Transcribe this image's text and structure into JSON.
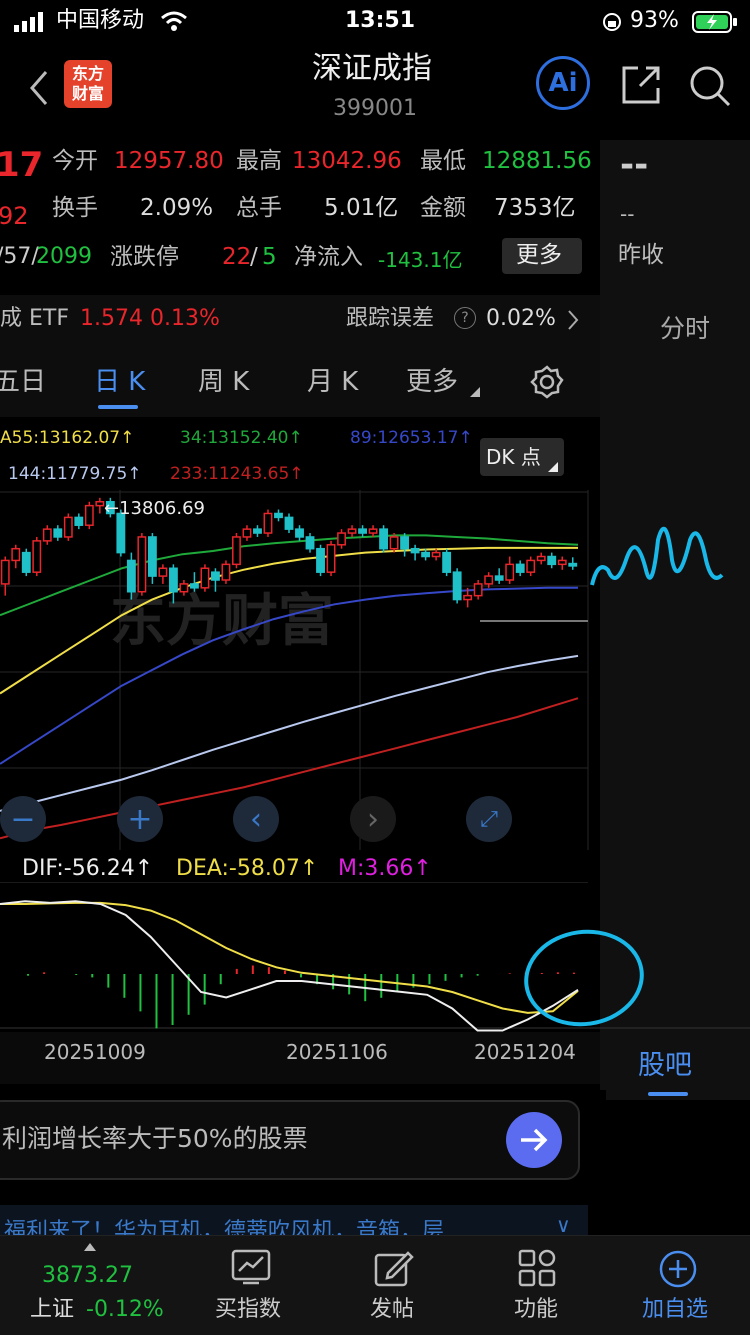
{
  "status_bar": {
    "carrier": "中国移动",
    "time": "13:51",
    "battery": "93%"
  },
  "header": {
    "title": "深证成指",
    "code": "399001",
    "logo_line1": "东方",
    "logo_line2": "财富",
    "ai_label": "Ai"
  },
  "quote": {
    "price_partial": "17",
    "change_partial": "92",
    "open_label": "今开",
    "open_value": "12957.80",
    "high_label": "最高",
    "high_value": "13042.96",
    "low_label": "最低",
    "low_value": "12881.56",
    "turnover_label": "换手",
    "turnover_value": "2.09%",
    "volume_label": "总手",
    "volume_value": "5.01亿",
    "amount_label": "金额",
    "amount_value": "7353亿",
    "adv_partial": "/57/",
    "decline_count": "2099",
    "limit_label": "涨跌停",
    "limit_up": "22",
    "limit_sep": "/",
    "limit_down": "5",
    "netflow_label": "净流入",
    "netflow_value": "-143.1亿",
    "more_button": "更多"
  },
  "right_panel": {
    "dash1": "--",
    "dash2": "--",
    "prev_close_label": "昨收",
    "tab_fenshi": "分时",
    "tab_guba": "股吧"
  },
  "etf": {
    "name": "成 ETF",
    "price": "1.574",
    "change": "0.13%",
    "tracking_label": "跟踪误差",
    "tracking_value": "0.02%"
  },
  "tabs": {
    "five_day": "五日",
    "day_k": "日 K",
    "week_k": "周 K",
    "month_k": "月 K",
    "more": "更多"
  },
  "ma_legend": {
    "ma55": "A55:13162.07↑",
    "ma34": "34:13152.40↑",
    "ma89": "89:12653.17↑",
    "ma144": "144:11779.75↑",
    "ma233": "233:11243.65↑",
    "dk_button": "DK 点"
  },
  "chart_data": {
    "type": "candlestick",
    "max_label": "←13806.69",
    "date_labels": [
      "20251009",
      "20251106",
      "20251204"
    ],
    "candles": [
      {
        "o": 12.7,
        "c": 13.0,
        "h": 13.05,
        "l": 12.55
      },
      {
        "o": 13.0,
        "c": 13.15,
        "h": 13.2,
        "l": 12.9
      },
      {
        "o": 13.1,
        "c": 12.85,
        "h": 13.15,
        "l": 12.8
      },
      {
        "o": 12.85,
        "c": 13.25,
        "h": 13.3,
        "l": 12.8
      },
      {
        "o": 13.25,
        "c": 13.4,
        "h": 13.45,
        "l": 13.2
      },
      {
        "o": 13.4,
        "c": 13.3,
        "h": 13.45,
        "l": 13.25
      },
      {
        "o": 13.3,
        "c": 13.55,
        "h": 13.6,
        "l": 13.25
      },
      {
        "o": 13.55,
        "c": 13.45,
        "h": 13.6,
        "l": 13.4
      },
      {
        "o": 13.45,
        "c": 13.7,
        "h": 13.75,
        "l": 13.4
      },
      {
        "o": 13.7,
        "c": 13.75,
        "h": 13.8,
        "l": 13.6
      },
      {
        "o": 13.75,
        "c": 13.6,
        "h": 13.8,
        "l": 13.55
      },
      {
        "o": 13.6,
        "c": 13.1,
        "h": 13.65,
        "l": 13.05
      },
      {
        "o": 13.0,
        "c": 12.6,
        "h": 13.1,
        "l": 12.5
      },
      {
        "o": 12.6,
        "c": 13.3,
        "h": 13.35,
        "l": 12.55
      },
      {
        "o": 13.3,
        "c": 12.8,
        "h": 13.35,
        "l": 12.7
      },
      {
        "o": 12.8,
        "c": 12.9,
        "h": 12.95,
        "l": 12.7
      },
      {
        "o": 12.9,
        "c": 12.6,
        "h": 12.95,
        "l": 12.45
      },
      {
        "o": 12.6,
        "c": 12.7,
        "h": 12.75,
        "l": 12.55
      },
      {
        "o": 12.7,
        "c": 12.65,
        "h": 12.85,
        "l": 12.6
      },
      {
        "o": 12.65,
        "c": 12.9,
        "h": 12.95,
        "l": 12.6
      },
      {
        "o": 12.85,
        "c": 12.75,
        "h": 12.9,
        "l": 12.6
      },
      {
        "o": 12.75,
        "c": 12.95,
        "h": 13.0,
        "l": 12.7
      },
      {
        "o": 12.95,
        "c": 13.3,
        "h": 13.35,
        "l": 12.9
      },
      {
        "o": 13.3,
        "c": 13.4,
        "h": 13.45,
        "l": 13.25
      },
      {
        "o": 13.4,
        "c": 13.35,
        "h": 13.45,
        "l": 13.3
      },
      {
        "o": 13.35,
        "c": 13.6,
        "h": 13.65,
        "l": 13.3
      },
      {
        "o": 13.6,
        "c": 13.55,
        "h": 13.65,
        "l": 13.5
      },
      {
        "o": 13.55,
        "c": 13.4,
        "h": 13.6,
        "l": 13.35
      },
      {
        "o": 13.4,
        "c": 13.3,
        "h": 13.45,
        "l": 13.25
      },
      {
        "o": 13.3,
        "c": 13.15,
        "h": 13.35,
        "l": 13.1
      },
      {
        "o": 13.15,
        "c": 12.85,
        "h": 13.2,
        "l": 12.8
      },
      {
        "o": 12.85,
        "c": 13.2,
        "h": 13.25,
        "l": 12.8
      },
      {
        "o": 13.2,
        "c": 13.35,
        "h": 13.4,
        "l": 13.15
      },
      {
        "o": 13.35,
        "c": 13.4,
        "h": 13.45,
        "l": 13.3
      },
      {
        "o": 13.4,
        "c": 13.35,
        "h": 13.45,
        "l": 13.3
      },
      {
        "o": 13.35,
        "c": 13.4,
        "h": 13.45,
        "l": 13.3
      },
      {
        "o": 13.4,
        "c": 13.15,
        "h": 13.45,
        "l": 13.1
      },
      {
        "o": 13.15,
        "c": 13.3,
        "h": 13.35,
        "l": 13.1
      },
      {
        "o": 13.3,
        "c": 13.15,
        "h": 13.35,
        "l": 13.05
      },
      {
        "o": 13.15,
        "c": 13.1,
        "h": 13.2,
        "l": 13.0
      },
      {
        "o": 13.1,
        "c": 13.05,
        "h": 13.15,
        "l": 13.0
      },
      {
        "o": 13.05,
        "c": 13.1,
        "h": 13.15,
        "l": 13.0
      },
      {
        "o": 13.1,
        "c": 12.85,
        "h": 13.15,
        "l": 12.8
      },
      {
        "o": 12.85,
        "c": 12.5,
        "h": 12.9,
        "l": 12.45
      },
      {
        "o": 12.5,
        "c": 12.55,
        "h": 12.65,
        "l": 12.4
      },
      {
        "o": 12.55,
        "c": 12.7,
        "h": 12.75,
        "l": 12.5
      },
      {
        "o": 12.7,
        "c": 12.8,
        "h": 12.85,
        "l": 12.65
      },
      {
        "o": 12.8,
        "c": 12.75,
        "h": 12.9,
        "l": 12.7
      },
      {
        "o": 12.75,
        "c": 12.95,
        "h": 13.05,
        "l": 12.7
      },
      {
        "o": 12.95,
        "c": 12.85,
        "h": 13.0,
        "l": 12.8
      },
      {
        "o": 12.85,
        "c": 13.0,
        "h": 13.05,
        "l": 12.8
      },
      {
        "o": 13.0,
        "c": 13.05,
        "h": 13.1,
        "l": 12.95
      },
      {
        "o": 13.05,
        "c": 12.95,
        "h": 13.1,
        "l": 12.9
      },
      {
        "o": 12.95,
        "c": 13.0,
        "h": 13.05,
        "l": 12.88
      },
      {
        "o": 12.96,
        "c": 12.93,
        "h": 13.04,
        "l": 12.88
      }
    ],
    "ma_lines": [
      {
        "name": "MA34",
        "color": "#1fa93a",
        "values": [
          12.3,
          12.45,
          12.6,
          12.75,
          12.9,
          13.0,
          13.08,
          13.12,
          13.18,
          13.22,
          13.25,
          13.28,
          13.3,
          13.32,
          13.32,
          13.3,
          13.28,
          13.25,
          13.22,
          13.2
        ]
      },
      {
        "name": "MA55",
        "color": "#f0de48",
        "values": [
          11.3,
          11.55,
          11.8,
          12.05,
          12.3,
          12.5,
          12.65,
          12.78,
          12.88,
          12.96,
          13.02,
          13.06,
          13.1,
          13.12,
          13.14,
          13.15,
          13.16,
          13.16,
          13.16,
          13.16
        ]
      },
      {
        "name": "MA89",
        "color": "#3648c8",
        "values": [
          10.4,
          10.65,
          10.9,
          11.15,
          11.4,
          11.6,
          11.8,
          11.98,
          12.12,
          12.25,
          12.35,
          12.44,
          12.5,
          12.55,
          12.58,
          12.61,
          12.63,
          12.64,
          12.65,
          12.65
        ]
      },
      {
        "name": "MA144",
        "color": "#b8c8ee",
        "values": [
          9.8,
          9.9,
          10.0,
          10.1,
          10.2,
          10.32,
          10.45,
          10.58,
          10.7,
          10.82,
          10.94,
          11.05,
          11.16,
          11.27,
          11.37,
          11.47,
          11.57,
          11.65,
          11.72,
          11.78
        ]
      },
      {
        "name": "MA233",
        "color": "#c02020",
        "values": [
          9.45,
          9.55,
          9.62,
          9.7,
          9.78,
          9.86,
          9.94,
          10.02,
          10.1,
          10.2,
          10.3,
          10.4,
          10.5,
          10.6,
          10.7,
          10.8,
          10.9,
          11.0,
          11.12,
          11.24
        ]
      }
    ],
    "y_range": [
      9.3,
      13.9
    ],
    "macd": {
      "dif_label": "DIF:-56.24↑",
      "dea_label": "DEA:-58.07↑",
      "m_label": "M:3.66↑",
      "dif": [
        100,
        105,
        102,
        105,
        100,
        80,
        40,
        -10,
        -60,
        -70,
        -55,
        -40,
        -40,
        -45,
        -50,
        -55,
        -60,
        -65,
        -90,
        -130,
        -130,
        -110,
        -85,
        -56
      ],
      "dea": [
        100,
        100,
        101,
        102,
        102,
        98,
        88,
        70,
        45,
        20,
        0,
        -15,
        -25,
        -30,
        -35,
        -40,
        -45,
        -50,
        -60,
        -75,
        -90,
        -98,
        -95,
        -58
      ],
      "hist": [
        0,
        -5,
        5,
        0,
        -3,
        -10,
        -40,
        -70,
        -110,
        -160,
        -150,
        -120,
        -90,
        -30,
        15,
        25,
        20,
        10,
        -10,
        -30,
        -45,
        -60,
        -80,
        -70,
        -50,
        -40,
        -30,
        -20,
        -10,
        -5,
        0,
        2,
        4,
        3,
        5,
        4
      ]
    }
  },
  "ai_prompt": {
    "text": "利润增长率大于50%的股票"
  },
  "ticker": {
    "text": "福利来了！华为耳机，德蒂吹风机，音箱，层"
  },
  "bottom_bar": {
    "index_value": "3873.27",
    "index_name": "上证",
    "index_change": "-0.12%",
    "buy_index": "买指数",
    "post": "发帖",
    "features": "功能",
    "add_watch": "加自选"
  },
  "colors": {
    "up": "#e8262b",
    "down": "#20c040",
    "accent": "#4a8ff0",
    "annotation": "#19b8e8"
  }
}
